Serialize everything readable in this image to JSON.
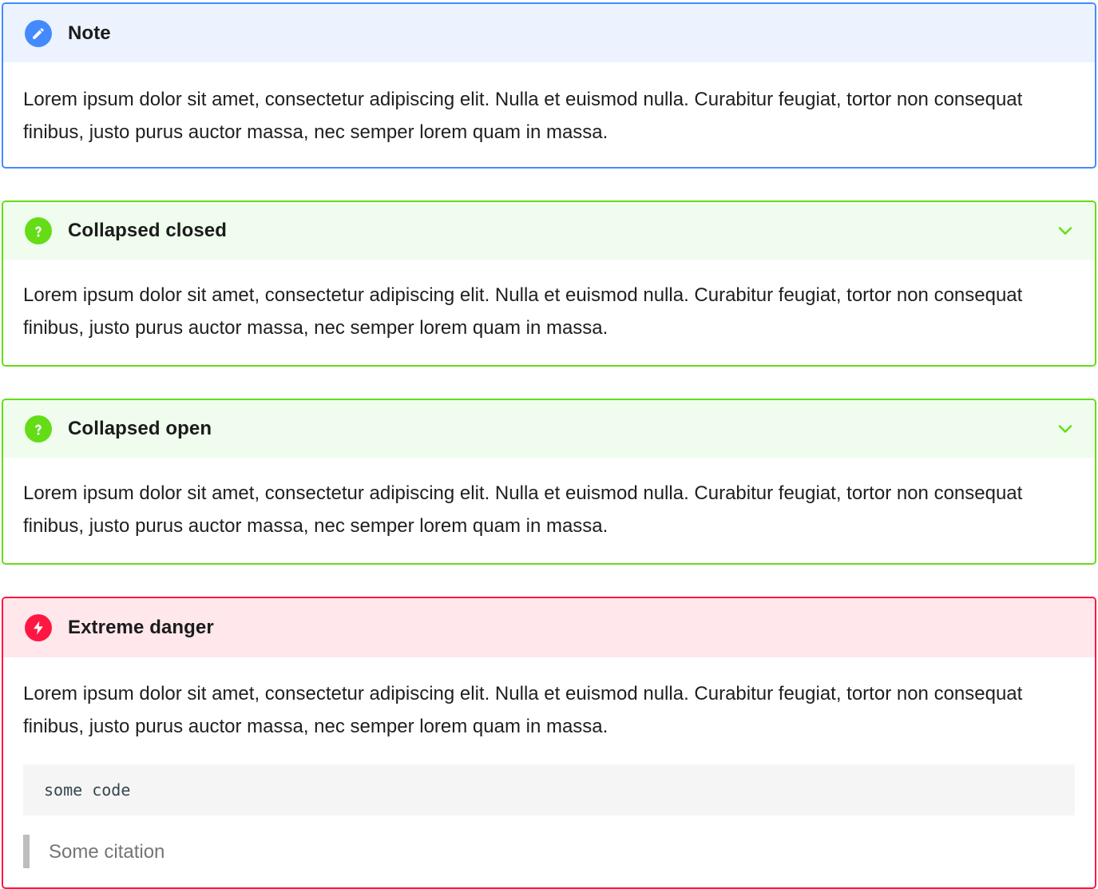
{
  "colors": {
    "note": "#448aff",
    "question": "#64dd17",
    "danger": "#ff1744"
  },
  "admonitions": [
    {
      "title": "Note",
      "icon": "pencil-icon",
      "body": "Lorem ipsum dolor sit amet, consectetur adipiscing elit. Nulla et euismod nulla. Curabitur feugiat, tortor non consequat finibus, justo purus auctor massa, nec semper lorem quam in massa."
    },
    {
      "title": "Collapsed closed",
      "icon": "question-icon",
      "collapsible": true,
      "body": "Lorem ipsum dolor sit amet, consectetur adipiscing elit. Nulla et euismod nulla. Curabitur feugiat, tortor non consequat finibus, justo purus auctor massa, nec semper lorem quam in massa."
    },
    {
      "title": "Collapsed open",
      "icon": "question-icon",
      "collapsible": true,
      "body": "Lorem ipsum dolor sit amet, consectetur adipiscing elit. Nulla et euismod nulla. Curabitur feugiat, tortor non consequat finibus, justo purus auctor massa, nec semper lorem quam in massa."
    },
    {
      "title": "Extreme danger",
      "icon": "lightning-icon",
      "body": "Lorem ipsum dolor sit amet, consectetur adipiscing elit. Nulla et euismod nulla. Curabitur feugiat, tortor non consequat finibus, justo purus auctor massa, nec semper lorem quam in massa.",
      "code": "some code",
      "citation": "Some citation"
    }
  ]
}
